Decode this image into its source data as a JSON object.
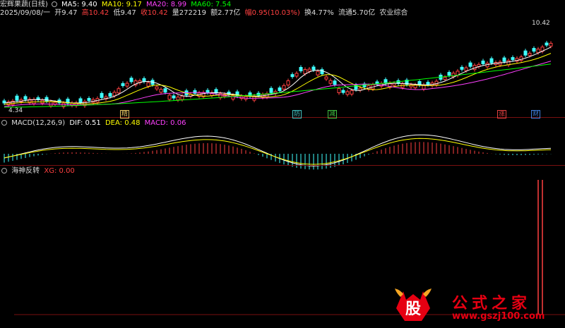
{
  "header": {
    "stock_name": "宏辉果蔬(日线)",
    "ma5": "MA5: 9.40",
    "ma10": "MA10: 9.17",
    "ma20": "MA20: 8.99",
    "ma60": "MA60: 7.54",
    "date": "2025/09/08/一",
    "open": "开9.47",
    "high": "高10.42",
    "low": "低9.47",
    "close": "收10.42",
    "volume": "量272219",
    "amount": "额2.77亿",
    "change": "幅0.95(10.03%)",
    "turnover": "换4.77%",
    "float": "流通5.70亿",
    "sector": "农业综合"
  },
  "price_labels": {
    "high": "10.42",
    "low": "4.34"
  },
  "tags": [
    {
      "text": "精",
      "color": "#e0c060"
    },
    {
      "text": "防",
      "color": "#40c0c0"
    },
    {
      "text": "减",
      "color": "#40c040"
    },
    {
      "text": "涨",
      "color": "#e04040"
    },
    {
      "text": "财",
      "color": "#4080e0"
    }
  ],
  "macd": {
    "title": "MACD(12,26,9)",
    "dif": "DIF: 0.51",
    "dea": "DEA: 0.48",
    "macd": "MACD: 0.06"
  },
  "indicator": {
    "name": "海神反转",
    "xg": "XG: 0.00"
  },
  "watermark": {
    "logo": "股",
    "text": "公式之家",
    "url": "www.gszj100.com"
  },
  "colors": {
    "ma5": "#ffffff",
    "ma10": "#ffff00",
    "ma20": "#ff40ff",
    "ma60": "#00ff00",
    "up": "#ff4040",
    "down": "#40ffff"
  }
}
